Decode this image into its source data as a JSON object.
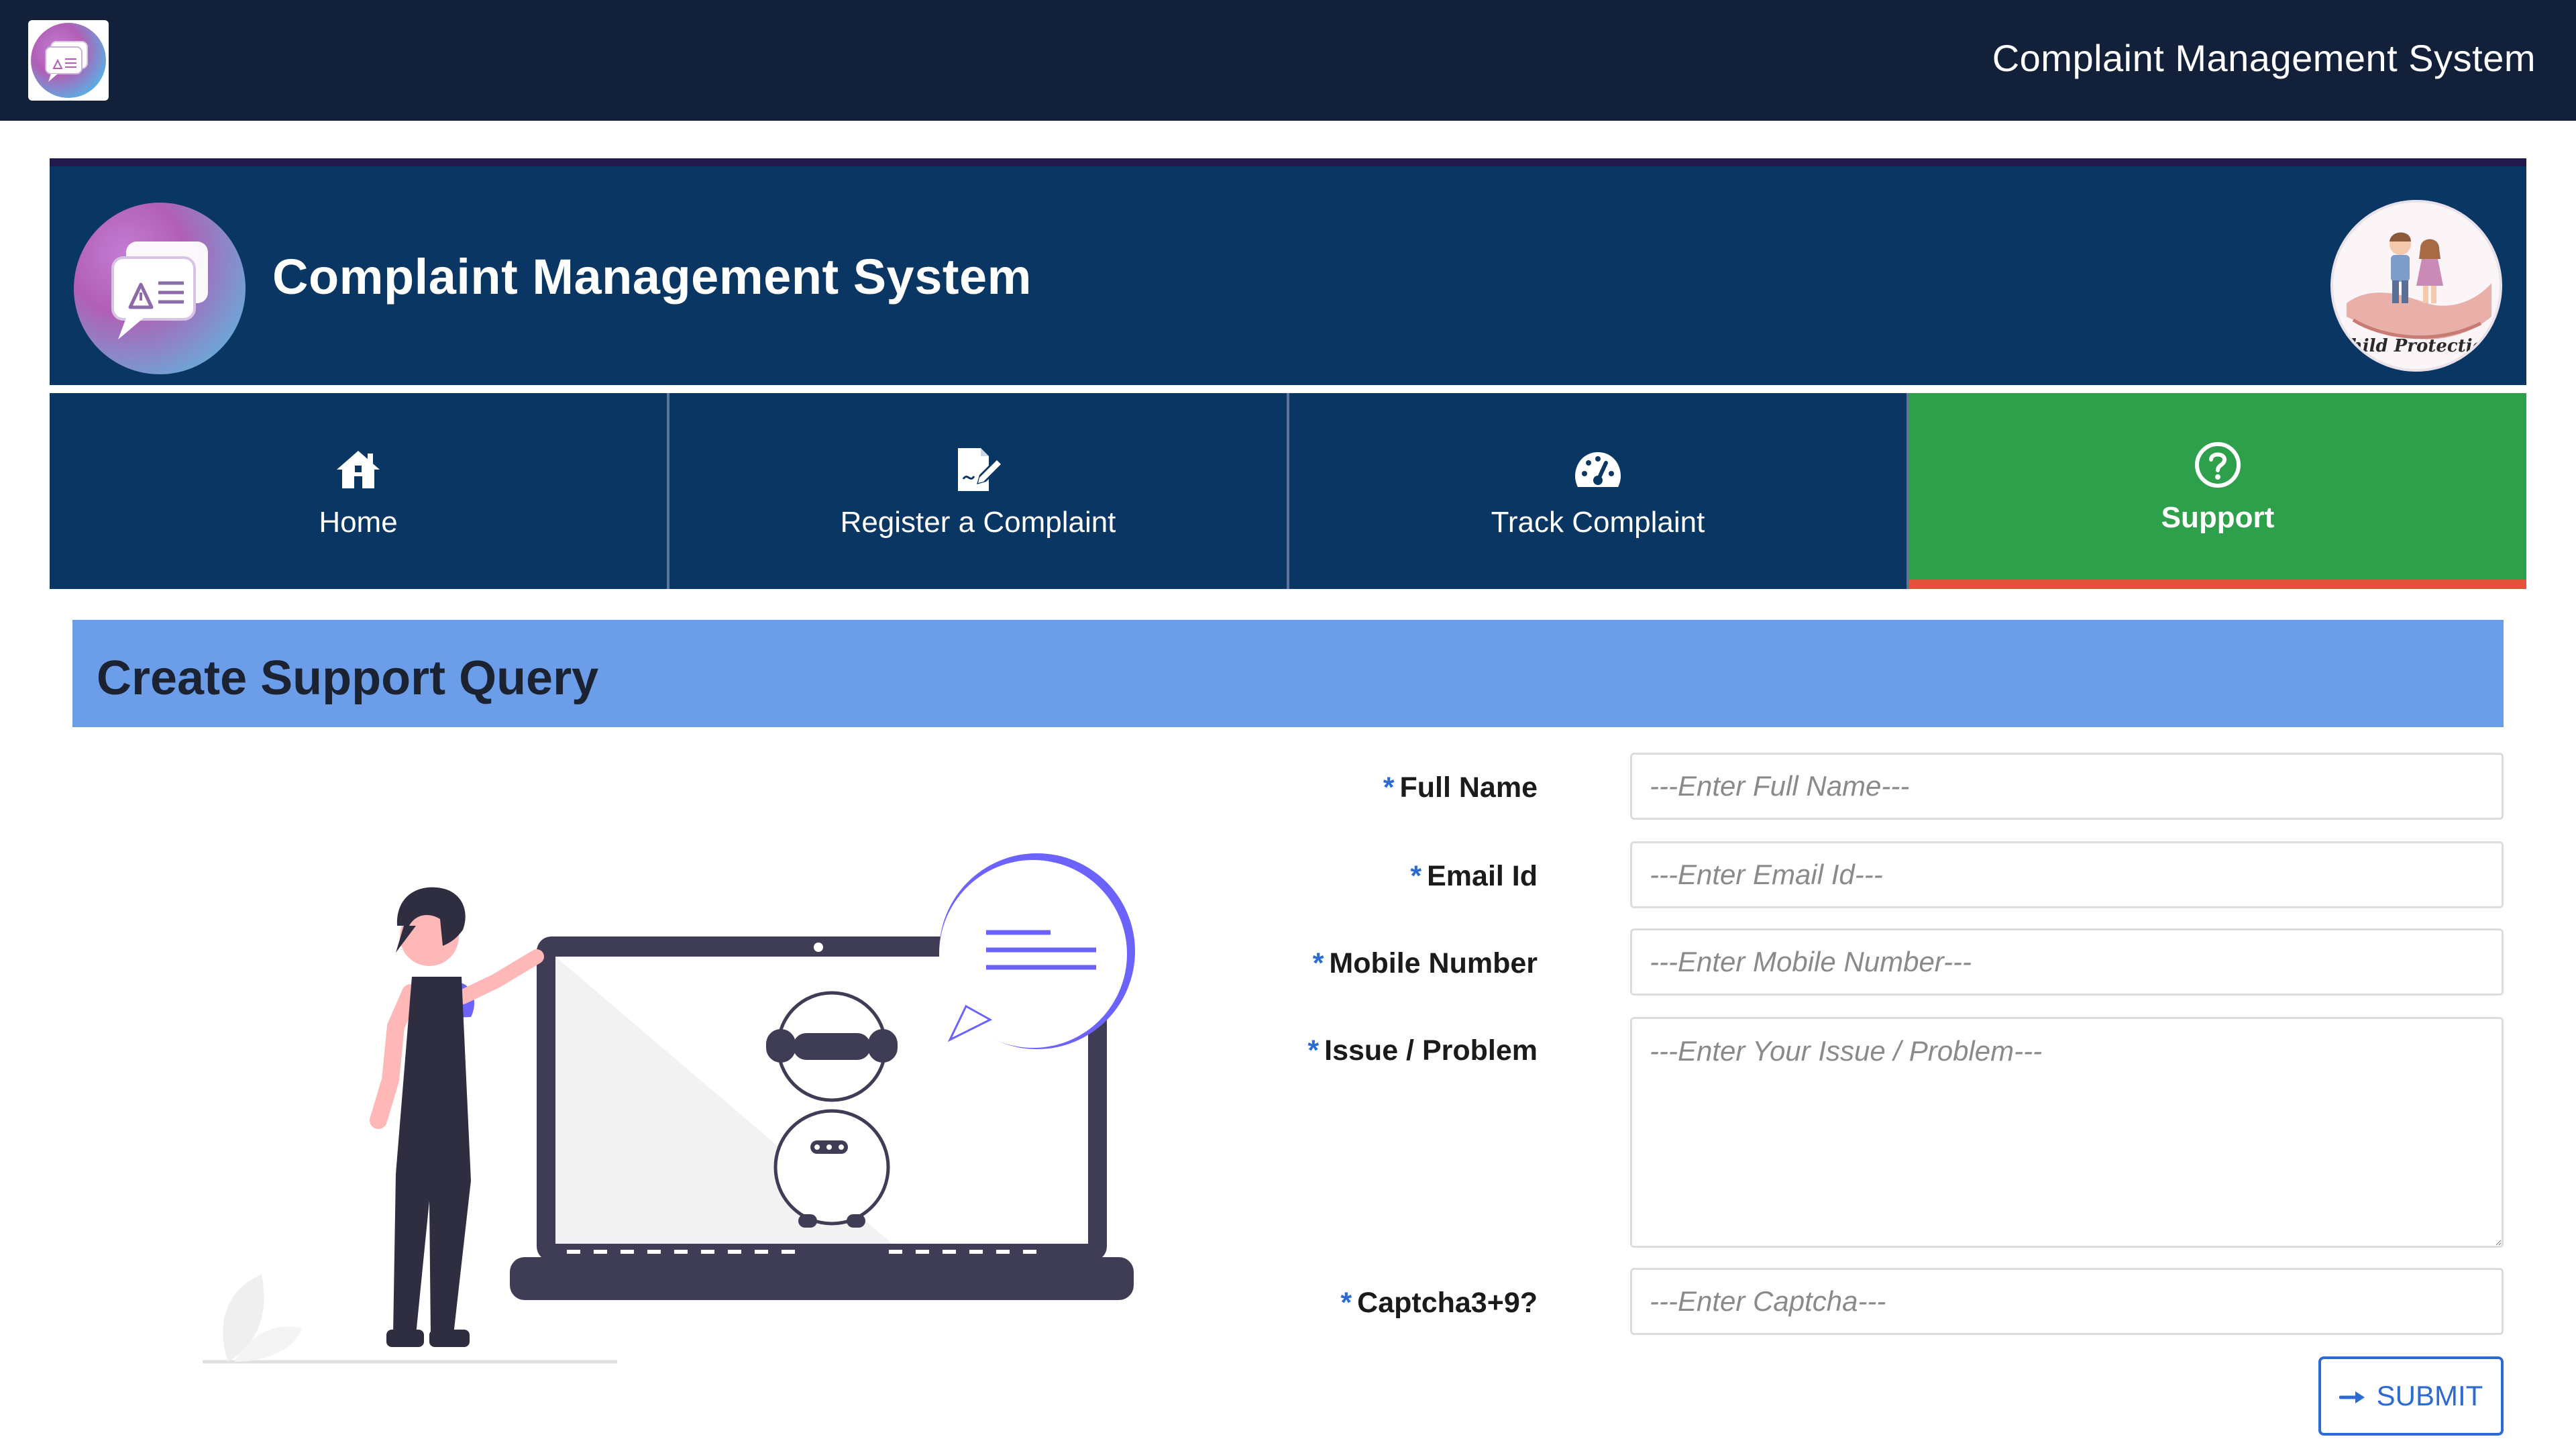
{
  "topbar": {
    "title": "Complaint Management System",
    "logo_icon": "complaint-chat-icon"
  },
  "banner": {
    "title": "Complaint Management System",
    "badge_text": "Child Protection"
  },
  "nav": {
    "items": [
      {
        "label": "Home",
        "icon": "home-icon"
      },
      {
        "label": "Register a Complaint",
        "icon": "edit-document-icon"
      },
      {
        "label": "Track Complaint",
        "icon": "gauge-icon"
      },
      {
        "label": "Support",
        "icon": "question-circle-icon"
      }
    ],
    "active_index": 3
  },
  "section": {
    "title": "Create Support Query"
  },
  "form": {
    "full_name": {
      "label": "Full Name",
      "placeholder": "---Enter Full Name---",
      "value": ""
    },
    "email": {
      "label": "Email Id",
      "placeholder": "---Enter Email Id---",
      "value": ""
    },
    "mobile": {
      "label": "Mobile Number",
      "placeholder": "---Enter Mobile Number---",
      "value": ""
    },
    "issue": {
      "label": "Issue / Problem",
      "placeholder": "---Enter Your Issue / Problem---",
      "value": ""
    },
    "captcha": {
      "label": "Captcha3+9?",
      "placeholder": "---Enter Captcha---",
      "value": ""
    },
    "required_marker": "*",
    "submit_label": "SUBMIT"
  },
  "colors": {
    "topbar": "#13203a",
    "banner": "#0a3663",
    "nav": "#0a3663",
    "nav_active": "#2e9f4a",
    "nav_active_underline": "#e2533e",
    "section_header": "#6b9de8",
    "accent": "#2d6ad1"
  }
}
